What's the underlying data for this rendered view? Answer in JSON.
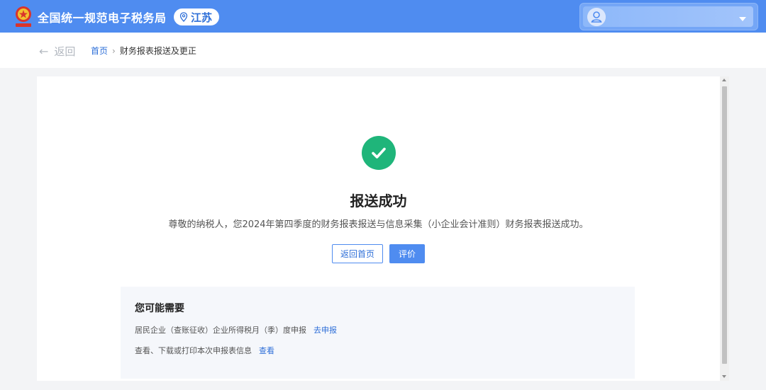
{
  "header": {
    "site_title": "全国统一规范电子税务局",
    "region": "江苏",
    "emblem_icon": "national-emblem-icon",
    "location_icon": "location-pin-icon",
    "user_icon": "user-avatar-icon",
    "dropdown_icon": "chevron-down-icon"
  },
  "nav": {
    "back_label": "返回",
    "back_icon": "arrow-left-icon",
    "breadcrumb": [
      "首页",
      "财务报表报送及更正"
    ],
    "separator": "›"
  },
  "result": {
    "status_icon": "success-check-icon",
    "title": "报送成功",
    "message": "尊敬的纳税人，您2024年第四季度的财务报表报送与信息采集（小企业会计准则）财务报表报送成功。",
    "return_home_button": "返回首页",
    "rate_button": "评价"
  },
  "suggestions": {
    "heading": "您可能需要",
    "items": [
      {
        "text": "居民企业（查账征收）企业所得税月（季）度申报",
        "link": "去申报"
      },
      {
        "text": "查看、下载或打印本次申报表信息",
        "link": "查看"
      }
    ]
  },
  "colors": {
    "primary": "#4f8cf0",
    "success": "#1fb57a",
    "link": "#2e6fd8"
  }
}
